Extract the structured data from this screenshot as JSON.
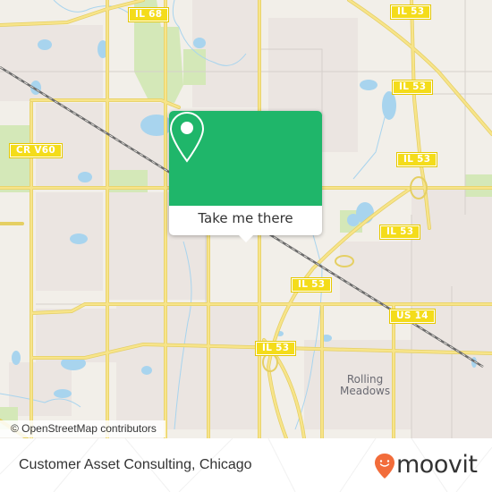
{
  "map": {
    "road_shields": [
      {
        "id": "il68",
        "label": "IL 68"
      },
      {
        "id": "il53-top",
        "label": "IL 53"
      },
      {
        "id": "il53-mid",
        "label": "IL 53"
      },
      {
        "id": "il53-east",
        "label": "IL 53"
      },
      {
        "id": "crv60",
        "label": "CR V60"
      },
      {
        "id": "il53-center",
        "label": "IL 53"
      },
      {
        "id": "us14",
        "label": "US 14"
      },
      {
        "id": "il53-south",
        "label": "IL 53"
      }
    ],
    "place_labels": {
      "rolling_meadows_line1": "Rolling",
      "rolling_meadows_line2": "Meadows"
    },
    "attribution": "© OpenStreetMap contributors",
    "colors": {
      "land": "#f2efe9",
      "residential": "#ebe5e1",
      "park": "#d4e8b8",
      "water": "#a8d4ee",
      "road": "#f6e27a",
      "railway": "#6b6b6b"
    }
  },
  "popup": {
    "icon": "location-pin-icon",
    "button_label": "Take me there",
    "accent_color": "#1fb66a"
  },
  "footer": {
    "title": "Customer Asset Consulting, Chicago",
    "logo_text": "moovit",
    "logo_color": "#f26c3a"
  }
}
